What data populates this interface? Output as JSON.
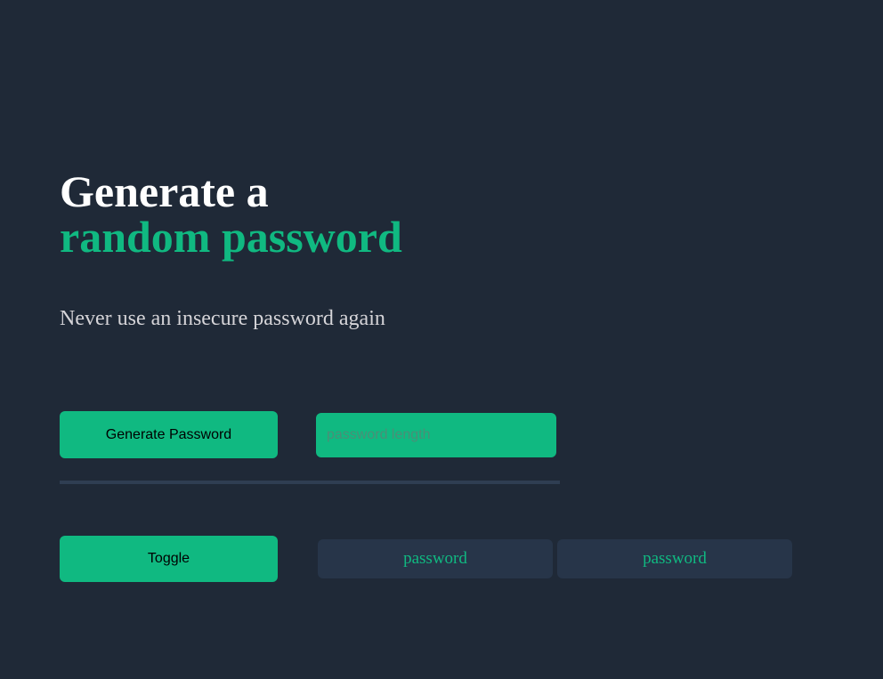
{
  "hero": {
    "title_line1": "Generate a",
    "title_line2": "random password",
    "subtitle": "Never use an insecure password again"
  },
  "controls": {
    "generate_label": "Generate Password",
    "length_placeholder": "password length",
    "length_value": "",
    "toggle_label": "Toggle"
  },
  "passwords": [
    {
      "text": "password"
    },
    {
      "text": "password"
    }
  ],
  "colors": {
    "background": "#1f2937",
    "accent": "#10b981",
    "password_box": "#273549",
    "divider": "#2f3e52"
  }
}
